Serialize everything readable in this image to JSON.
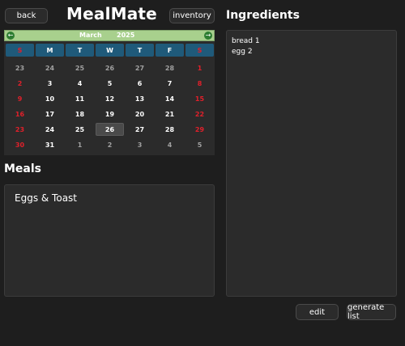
{
  "header": {
    "back_label": "back",
    "title": "MealMate",
    "inventory_label": "inventory"
  },
  "calendar": {
    "month": "March",
    "year": "2025",
    "weekdays": [
      "S",
      "M",
      "T",
      "W",
      "T",
      "F",
      "S"
    ],
    "selected_day": "26",
    "weeks": [
      [
        "23",
        "24",
        "25",
        "26",
        "27",
        "28",
        "1"
      ],
      [
        "2",
        "3",
        "4",
        "5",
        "6",
        "7",
        "8"
      ],
      [
        "9",
        "10",
        "11",
        "12",
        "13",
        "14",
        "15"
      ],
      [
        "16",
        "17",
        "18",
        "19",
        "20",
        "21",
        "22"
      ],
      [
        "23",
        "24",
        "25",
        "26",
        "27",
        "28",
        "29"
      ],
      [
        "30",
        "31",
        "1",
        "2",
        "3",
        "4",
        "5"
      ]
    ],
    "colors": {
      "header_bg": "#a8d08d",
      "weekday_bg": "#1f5a7a",
      "weekend": "#e0202b",
      "other_month": "#a0a0a0"
    }
  },
  "meals": {
    "title": "Meals",
    "items": [
      "Eggs & Toast"
    ]
  },
  "ingredients": {
    "title": "Ingredients",
    "items": [
      "bread 1",
      "egg 2"
    ]
  },
  "actions": {
    "edit_label": "edit",
    "generate_label": "generate list"
  }
}
